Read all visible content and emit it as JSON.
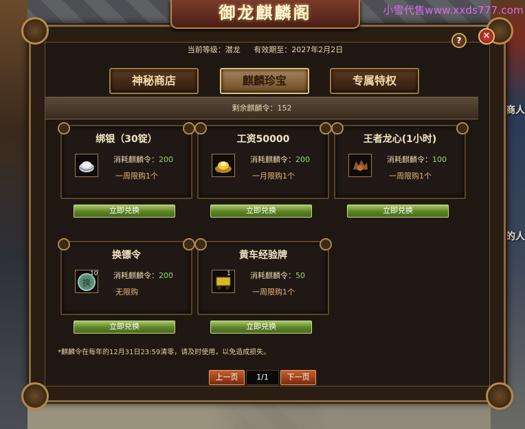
{
  "watermark": "小雪代售www.xxds777.com",
  "title": "御龙麒麟阁",
  "side_texts": [
    "石商人",
    "名的人"
  ],
  "header": {
    "level_label": "当前等级：",
    "level_value": "潜龙",
    "expiry_label": "有效期至：",
    "expiry_value": "2027年2月2日"
  },
  "tabs": [
    {
      "label": "神秘商店",
      "active": false
    },
    {
      "label": "麒麟珍宝",
      "active": true
    },
    {
      "label": "专属特权",
      "active": false
    }
  ],
  "balance": {
    "label": "剩余麒麟令：",
    "value": "152"
  },
  "items": [
    {
      "name": "绑银（30锭）",
      "cost_label": "消耗麒麟令：",
      "cost": "200",
      "limit": "一周限购1个",
      "icon": "silver-ingot-icon",
      "count": "",
      "button": "立即兑换"
    },
    {
      "name": "工资50000",
      "cost_label": "消耗麒麟令：",
      "cost": "200",
      "limit": "一月限购1个",
      "icon": "gold-ingot-icon",
      "count": "",
      "button": "立即兑换"
    },
    {
      "name": "王者龙心(1小时)",
      "cost_label": "消耗麒麟令：",
      "cost": "100",
      "limit": "一周限购1个",
      "icon": "dragon-heart-icon",
      "count": "",
      "button": "立即兑换"
    },
    {
      "name": "换镖令",
      "cost_label": "消耗麒麟令：",
      "cost": "200",
      "limit": "无限购",
      "icon": "escort-token-icon",
      "count": "10",
      "button": "立即兑换"
    },
    {
      "name": "黄车经验牌",
      "cost_label": "消耗麒麟令：",
      "cost": "50",
      "limit": "一周限购1个",
      "icon": "yellow-cart-icon",
      "count": "1",
      "button": "立即兑换"
    }
  ],
  "notice": "*麒麟令在每年的12月31日23:59清零，请及时使用，以免造成损失。",
  "pager": {
    "prev": "上一页",
    "page": "1/1",
    "next": "下一页"
  },
  "buttons": {
    "help": "?",
    "close": "✕"
  }
}
